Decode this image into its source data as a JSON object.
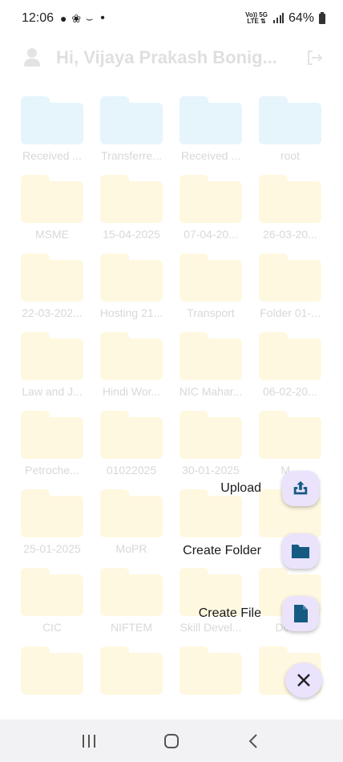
{
  "status_bar": {
    "time": "12:06",
    "notif_icons": "● ❀ ⌣",
    "dot": "•",
    "network_top": "Vo)) 5G",
    "network_bottom": "LTE ⇅",
    "battery": "64%"
  },
  "header": {
    "greeting": "Hi, Vijaya Prakash Bonig..."
  },
  "folders": [
    {
      "label": "Received ...",
      "color": "blue"
    },
    {
      "label": "Transferre...",
      "color": "blue"
    },
    {
      "label": "Received ...",
      "color": "blue"
    },
    {
      "label": "root",
      "color": "blue"
    },
    {
      "label": "MSME",
      "color": "yellow"
    },
    {
      "label": "15-04-2025",
      "color": "yellow"
    },
    {
      "label": "07-04-20...",
      "color": "yellow"
    },
    {
      "label": "26-03-20...",
      "color": "yellow"
    },
    {
      "label": "22-03-202...",
      "color": "yellow"
    },
    {
      "label": "Hosting 21...",
      "color": "yellow"
    },
    {
      "label": "Transport",
      "color": "yellow"
    },
    {
      "label": "Folder 01-...",
      "color": "yellow"
    },
    {
      "label": "Law and J...",
      "color": "yellow"
    },
    {
      "label": "Hindi Wor...",
      "color": "yellow"
    },
    {
      "label": "NIC Mahar...",
      "color": "yellow"
    },
    {
      "label": "06-02-20...",
      "color": "yellow"
    },
    {
      "label": "Petroche...",
      "color": "yellow"
    },
    {
      "label": "01022025",
      "color": "yellow"
    },
    {
      "label": "30-01-2025",
      "color": "yellow"
    },
    {
      "label": "M...",
      "color": "yellow"
    },
    {
      "label": "25-01-2025",
      "color": "yellow"
    },
    {
      "label": "MoPR",
      "color": "yellow"
    },
    {
      "label": "",
      "color": "yellow"
    },
    {
      "label": "C...",
      "color": "yellow"
    },
    {
      "label": "CIC",
      "color": "yellow"
    },
    {
      "label": "NIFTEM",
      "color": "yellow"
    },
    {
      "label": "Skill Devel...",
      "color": "yellow"
    },
    {
      "label": "DoP...",
      "color": "yellow"
    },
    {
      "label": "",
      "color": "yellow"
    },
    {
      "label": "",
      "color": "yellow"
    },
    {
      "label": "",
      "color": "yellow"
    },
    {
      "label": "",
      "color": "yellow"
    }
  ],
  "fab_menu": {
    "upload_label": "Upload",
    "create_folder_label": "Create Folder",
    "create_file_label": "Create File"
  },
  "colors": {
    "accent": "#155a82",
    "fab_bg": "#eae3fb",
    "folder_blue": "#e6f4fb",
    "folder_yellow": "#fff8e0"
  }
}
